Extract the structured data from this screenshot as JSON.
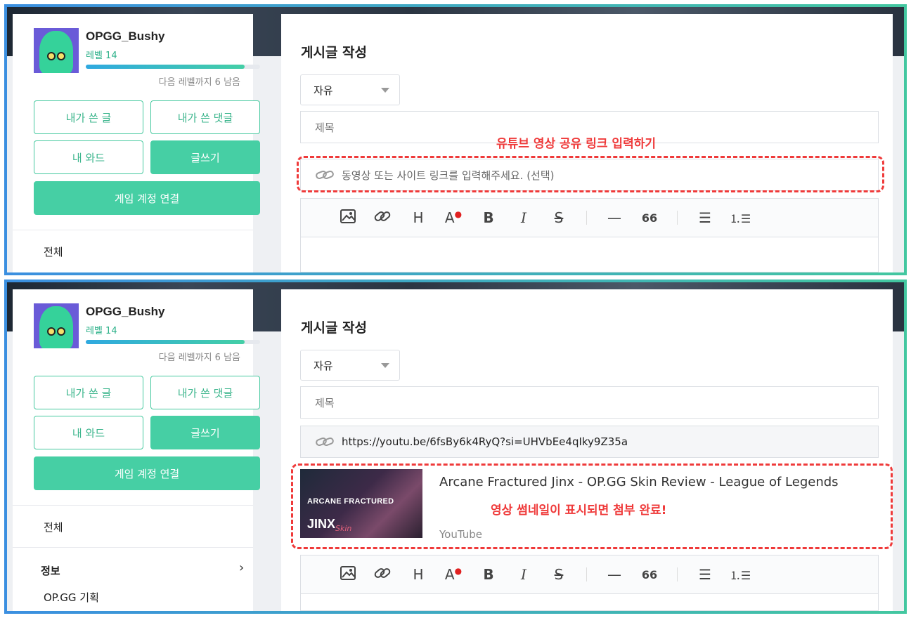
{
  "profile": {
    "username": "OPGG_Bushy",
    "level": "레벨 14",
    "xp_progress": 0.91,
    "next_level_note": "다음 레벨까지 6 남음"
  },
  "sidebar": {
    "buttons": {
      "my_posts": "내가 쓴 글",
      "my_comments": "내가 쓴 댓글",
      "my_ward": "내 와드",
      "write": "글쓰기",
      "link_account": "게임 계정 연결"
    },
    "nav": {
      "all": "전체",
      "info": "정보",
      "info_chevron": "›",
      "sub_item": "OP.GG 기획"
    }
  },
  "editor": {
    "page_title": "게시글 작성",
    "category": "자유",
    "title_placeholder": "제목",
    "link_placeholder": "동영상 또는 사이트 링크를 입력해주세요. (선택)",
    "link_value": "https://youtu.be/6fsBy6k4RyQ?si=UHVbEe4qIky9Z35a",
    "toolbar": [
      "image-icon",
      "link-icon",
      "heading-icon",
      "text-color-icon",
      "bold-icon",
      "italic-icon",
      "strikethrough-icon",
      "horizontal-rule-icon",
      "quote-icon",
      "bullet-list-icon",
      "numbered-list-icon"
    ]
  },
  "annotations": {
    "top_hint": "유튜브 영상 공유 링크 입력하기",
    "bottom_hint": "영상 썸네일이 표시되면 첨부 완료!"
  },
  "preview": {
    "title": "Arcane Fractured Jinx - OP.GG Skin Review - League of Legends",
    "source": "YouTube",
    "thumb_line1": "ARCANE FRACTURED",
    "thumb_line2": "JINX",
    "thumb_line3": "Skin"
  },
  "colors": {
    "accent": "#46cfa4",
    "annotation": "#ef3a3a"
  }
}
